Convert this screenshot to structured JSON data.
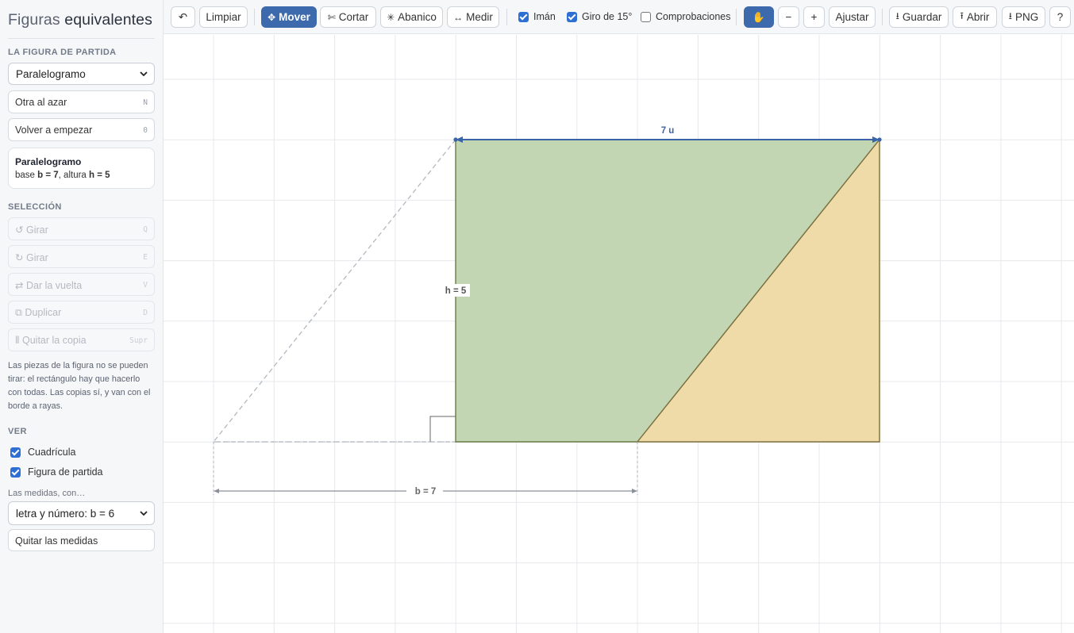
{
  "app": {
    "title_light": "Figuras",
    "title_bold": "equivalentes"
  },
  "sidebar": {
    "start_section": "LA FIGURA DE PARTIDA",
    "shape_select": "Paralelogramo",
    "random_button": "Otra al azar",
    "random_key": "N",
    "restart_button": "Volver a empezar",
    "restart_key": "0",
    "info_title": "Paralelogramo",
    "info_base_prefix": "base ",
    "info_base": "b = 7",
    "info_height_prefix": ", altura ",
    "info_height": "h = 5",
    "selection_section": "SELECCIÓN",
    "selection_buttons": [
      {
        "icon": "↺",
        "label": "Girar",
        "key": "Q"
      },
      {
        "icon": "↻",
        "label": "Girar",
        "key": "E"
      },
      {
        "icon": "⇄",
        "label": "Dar la vuelta",
        "key": "V"
      },
      {
        "icon": "⧉",
        "label": "Duplicar",
        "key": "D"
      },
      {
        "icon": "⦀",
        "label": "Quitar la copia",
        "key": "Supr"
      }
    ],
    "note": "Las piezas de la figura no se pueden tirar: el rectángulo hay que hacerlo con todas. Las copias sí, y van con el borde a rayas.",
    "view_section": "VER",
    "view_grid": "Cuadrícula",
    "view_start_shape": "Figura de partida",
    "measures_label": "Las medidas, con…",
    "measures_select": "letra y número: b = 6",
    "remove_measures": "Quitar las medidas"
  },
  "toolbar": {
    "undo": "↶",
    "clear": "Limpiar",
    "move": "Mover",
    "move_icon": "✥",
    "cut": "Cortar",
    "cut_icon": "✄",
    "fan": "Abanico",
    "fan_icon": "✳",
    "measure": "Medir",
    "measure_icon": "↔",
    "magnet": "Imán",
    "magnet_checked": true,
    "snap15": "Giro de 15°",
    "snap15_checked": true,
    "checks": "Comprobaciones",
    "checks_checked": false,
    "hand": "✋",
    "zoom_out": "−",
    "zoom_in": "+",
    "fit": "Ajustar",
    "save": "Guardar",
    "save_icon": "⭳",
    "open": "Abrir",
    "open_icon": "⭱",
    "png": "PNG",
    "png_icon": "⭳",
    "help": "?"
  },
  "canvas": {
    "top_label": "7 u",
    "height_label": "h = 5",
    "base_label": "b = 7",
    "colors": {
      "green_piece": "#c2d6b4",
      "yellow_piece": "#efdba8",
      "measure_blue": "#3b63a8",
      "grid": "#e6e8ec"
    }
  }
}
